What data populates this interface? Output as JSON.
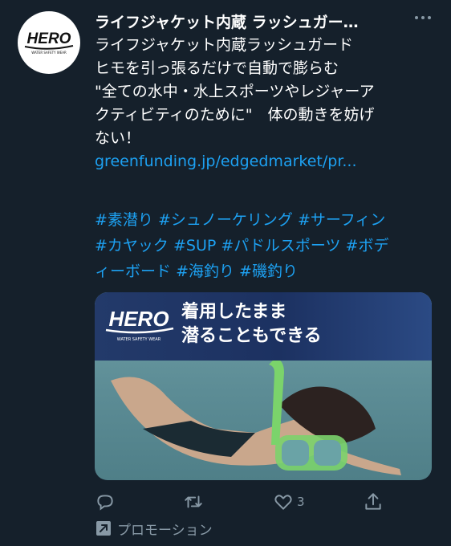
{
  "account": {
    "name": "ライフジャケット内蔵 ラッシュガー…",
    "logo_text": "HERO",
    "logo_subtext": "WATER SAFETY WEAR"
  },
  "tweet": {
    "lines": [
      "ライフジャケット内蔵ラッシュガード",
      "ヒモを引っ張るだけで自動で膨らむ",
      "\"全ての水中・水上スポーツやレジャーア",
      "クティビティのために\"　体の動きを妨げ",
      "ない！"
    ],
    "link": "greenfunding.jp/edgedmarket/pr...",
    "hashtag_lines": [
      [
        "#素潜り",
        "#シュノーケリング",
        "#サーフィン"
      ],
      [
        "#カヤック",
        "#SUP",
        "#パドルスポーツ",
        "#ボデ"
      ],
      [
        "ィーボード",
        "#海釣り",
        "#磯釣り"
      ]
    ]
  },
  "media": {
    "banner_line1": "着用したまま",
    "banner_line2": "潜ることもできる",
    "logo_text": "HERO",
    "logo_subtext": "WATER SAFETY WEAR"
  },
  "actions": {
    "reply_icon": "reply-icon",
    "retweet_icon": "retweet-icon",
    "like_icon": "heart-icon",
    "like_count": "3",
    "share_icon": "share-icon"
  },
  "promoted": {
    "icon": "promoted-arrow-icon",
    "label": "プロモーション"
  },
  "colors": {
    "background": "#15202b",
    "accent": "#1da1f2",
    "secondary_text": "#8899a6"
  }
}
